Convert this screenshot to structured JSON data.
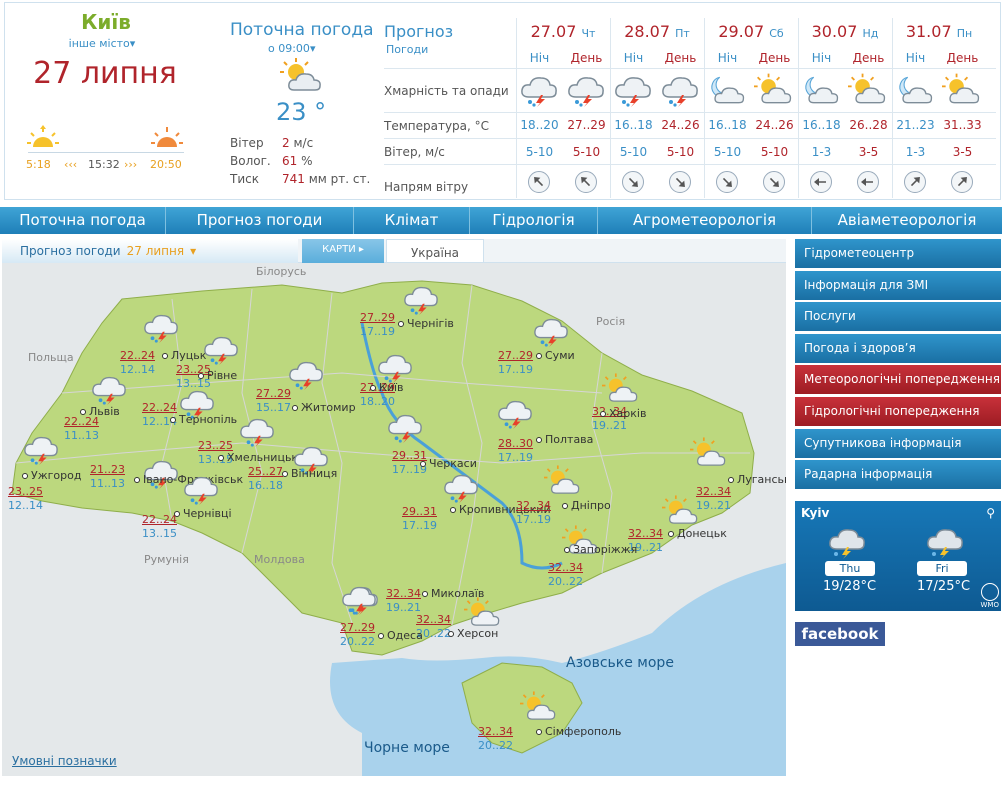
{
  "city": {
    "name": "Київ",
    "other": "інше місто"
  },
  "date": "27 липня",
  "sun": {
    "sunrise": "5:18",
    "daylen": "15:32",
    "sunset": "20:50"
  },
  "current": {
    "title": "Поточна погода",
    "time": "о 09:00",
    "temp": "23 °",
    "wind_label": "Вітер",
    "wind_value": "2",
    "wind_unit": "м/с",
    "hum_label": "Волог.",
    "hum_value": "61",
    "hum_unit": "%",
    "press_label": "Тиск",
    "press_value": "741",
    "press_unit": "мм рт. ст."
  },
  "forecast": {
    "title": "Прогноз",
    "subtitle": "Погоди",
    "row_labels": {
      "clouds": "Хмарність та опади",
      "temp": "Температура, °C",
      "wind": "Вітер, м/с",
      "dir": "Напрям вітру"
    },
    "night_label": "Ніч",
    "day_label": "День",
    "days": [
      {
        "date": "27.07",
        "dow": "Чт",
        "night": {
          "icon": "cloud-rain-storm-icon",
          "temp": "18..20",
          "wind": "5-10",
          "dir": "nw"
        },
        "day": {
          "icon": "cloud-rain-storm-icon",
          "temp": "27..29",
          "wind": "5-10",
          "dir": "nw"
        }
      },
      {
        "date": "28.07",
        "dow": "Пт",
        "night": {
          "icon": "cloud-rain-storm-icon",
          "temp": "16..18",
          "wind": "5-10",
          "dir": "se"
        },
        "day": {
          "icon": "cloud-rain-storm-icon",
          "temp": "24..26",
          "wind": "5-10",
          "dir": "se"
        }
      },
      {
        "date": "29.07",
        "dow": "Сб",
        "night": {
          "icon": "moon-cloud-icon",
          "temp": "16..18",
          "wind": "5-10",
          "dir": "se"
        },
        "day": {
          "icon": "sun-cloud-icon",
          "temp": "24..26",
          "wind": "5-10",
          "dir": "se"
        }
      },
      {
        "date": "30.07",
        "dow": "Нд",
        "night": {
          "icon": "moon-cloud-icon",
          "temp": "16..18",
          "wind": "1-3",
          "dir": "w"
        },
        "day": {
          "icon": "sun-cloud-icon",
          "temp": "26..28",
          "wind": "3-5",
          "dir": "w"
        }
      },
      {
        "date": "31.07",
        "dow": "Пн",
        "night": {
          "icon": "moon-cloud-icon",
          "temp": "21..23",
          "wind": "1-3",
          "dir": "ne"
        },
        "day": {
          "icon": "sun-cloud-icon",
          "temp": "31..33",
          "wind": "3-5",
          "dir": "ne"
        }
      }
    ]
  },
  "nav": [
    "Поточна погода",
    "Прогноз погоди",
    "Клімат",
    "Гідрологія",
    "Агрометеорологія",
    "Авіаметеорологія"
  ],
  "tabs": {
    "forecast": "Прогноз погоди",
    "forecast_date": "27 липня",
    "maps": "КАРТИ",
    "region": "Україна"
  },
  "map": {
    "countries": [
      "Білорусь",
      "Польща",
      "Росія",
      "Румунія",
      "Молдова"
    ],
    "seas": [
      "Азовське море",
      "Чорне море"
    ],
    "legend": "Умовні позначки",
    "cities": [
      {
        "name": "Чернігів",
        "t": "27..29",
        "n": "17..19",
        "icon": "cloud-rain-storm-icon"
      },
      {
        "name": "Луцьк",
        "t": "22..24",
        "n": "12..14",
        "icon": "cloud-rain-storm-icon"
      },
      {
        "name": "Рівне",
        "t": "23..25",
        "n": "13..15",
        "icon": "cloud-rain-storm-icon"
      },
      {
        "name": "Суми",
        "t": "27..29",
        "n": "17..19",
        "icon": "cloud-rain-storm-icon"
      },
      {
        "name": "Київ",
        "t": "27..29",
        "n": "18..20",
        "icon": "cloud-rain-storm-icon"
      },
      {
        "name": "Житомир",
        "t": "27..29",
        "n": "15..17",
        "icon": "cloud-rain-storm-icon"
      },
      {
        "name": "Львів",
        "t": "22..24",
        "n": "11..13",
        "icon": "cloud-rain-storm-icon"
      },
      {
        "name": "Тернопіль",
        "t": "22..24",
        "n": "12..14",
        "icon": "cloud-rain-storm-icon"
      },
      {
        "name": "Хмельницький",
        "t": "23..25",
        "n": "13..15",
        "icon": "cloud-rain-storm-icon"
      },
      {
        "name": "Харків",
        "t": "32..34",
        "n": "19..21",
        "icon": "sun-cloud-icon"
      },
      {
        "name": "Полтава",
        "t": "28..30",
        "n": "17..19",
        "icon": "cloud-rain-storm-icon"
      },
      {
        "name": "Ужгород",
        "t": "23..25",
        "n": "12..14",
        "icon": "cloud-rain-storm-icon"
      },
      {
        "name": "Івано-Франківськ",
        "t": "21..23",
        "n": "11..13",
        "icon": "cloud-rain-storm-icon"
      },
      {
        "name": "Вінниця",
        "t": "25..27",
        "n": "16..18",
        "icon": "cloud-rain-storm-icon"
      },
      {
        "name": "Черкаси",
        "t": "29..31",
        "n": "17..19",
        "icon": "cloud-rain-storm-icon"
      },
      {
        "name": "Луганськ",
        "t": "32..34",
        "n": "19..21",
        "icon": "sun-cloud-icon"
      },
      {
        "name": "Чернівці",
        "t": "22..24",
        "n": "13..15",
        "icon": "cloud-rain-storm-icon"
      },
      {
        "name": "Кропивницький",
        "t": "29..31",
        "n": "17..19",
        "icon": "cloud-rain-storm-icon"
      },
      {
        "name": "Дніпро",
        "t": "32..34",
        "n": "17..19",
        "icon": "sun-cloud-icon"
      },
      {
        "name": "Донецьк",
        "t": "32..34",
        "n": "19..21",
        "icon": "sun-cloud-icon"
      },
      {
        "name": "Запоріжжя",
        "t": "32..34",
        "n": "20..22",
        "icon": "sun-cloud-icon"
      },
      {
        "name": "Миколаїв",
        "t": "32..34",
        "n": "19..21",
        "icon": "cloud-rain-storm-icon"
      },
      {
        "name": "Херсон",
        "t": "32..34",
        "n": "20..22",
        "icon": "sun-cloud-icon"
      },
      {
        "name": "Одеса",
        "t": "27..29",
        "n": "20..22",
        "icon": "cloud-rain-storm-icon"
      },
      {
        "name": "Сімферополь",
        "t": "32..34",
        "n": "20..22",
        "icon": "sun-cloud-icon"
      }
    ]
  },
  "sidebar": [
    {
      "label": "Гідрометеоцентр",
      "style": "blue"
    },
    {
      "label": "Інформація для ЗМІ",
      "style": "blue"
    },
    {
      "label": "Послуги",
      "style": "blue"
    },
    {
      "label": "Погода і здоров’я",
      "style": "blue"
    },
    {
      "label": "Метеорологічні попередження",
      "style": "red"
    },
    {
      "label": "Гідрологічні попередження",
      "style": "red"
    },
    {
      "label": "Супутникова інформація",
      "style": "blue"
    },
    {
      "label": "Радарна інформація",
      "style": "blue"
    }
  ],
  "wmo": {
    "city": "Kyiv",
    "days": [
      {
        "day": "Thu",
        "temp": "19/28°C"
      },
      {
        "day": "Fri",
        "temp": "17/25°C"
      }
    ],
    "logo": "WMO"
  },
  "facebook": "facebook",
  "colors": {
    "accent": "#3a8fc6",
    "red": "#b0242b",
    "green": "#7cac2b",
    "land": "#bcd87e",
    "sea": "#a9d2ec"
  }
}
